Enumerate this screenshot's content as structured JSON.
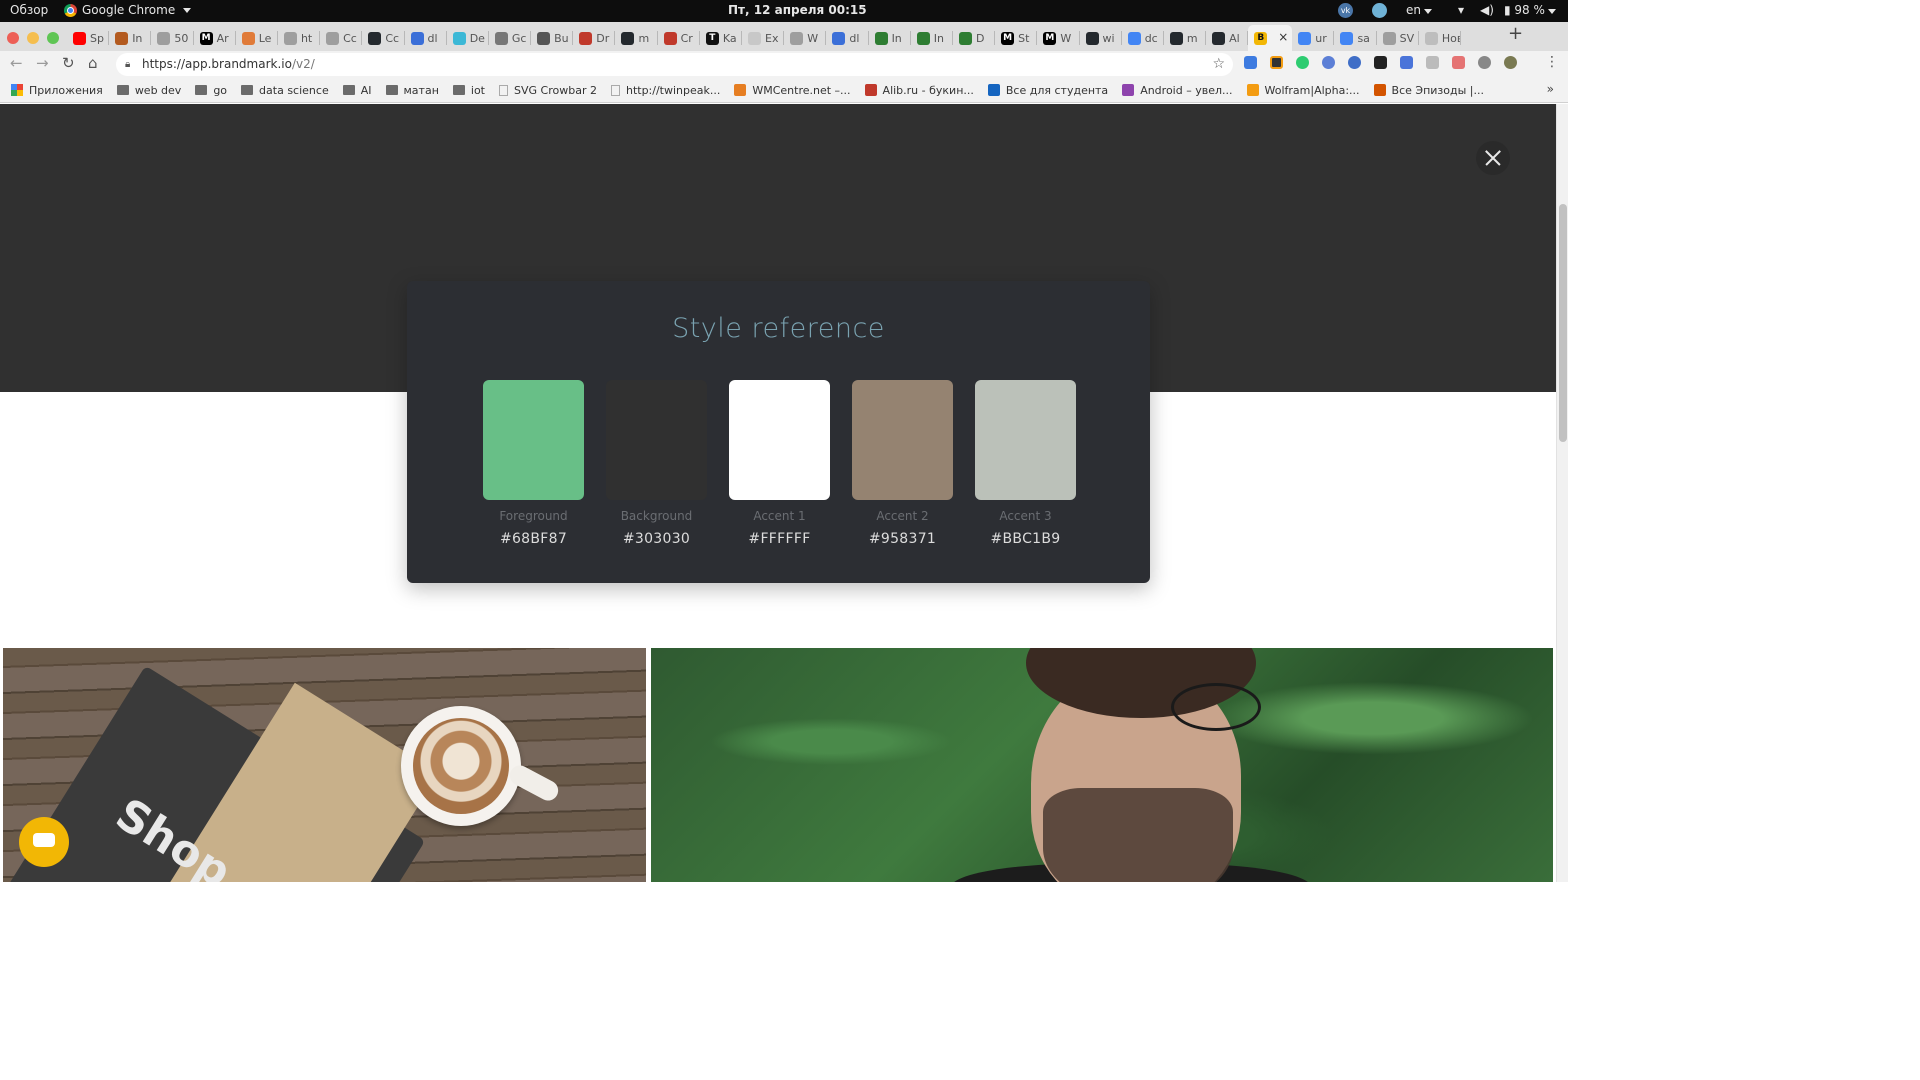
{
  "os_bar": {
    "activities": "Обзор",
    "app_name": "Google Chrome",
    "clock": "Пт, 12 апреля  00:15",
    "lang": "en",
    "battery": "98 %"
  },
  "tabs": [
    {
      "label": "Sp",
      "color": "#ff0000"
    },
    {
      "label": "In",
      "color": "#b35a1f"
    },
    {
      "label": "50",
      "color": "#9e9e9e"
    },
    {
      "label": "Ar",
      "color": "#000000",
      "glyph": "M"
    },
    {
      "label": "Le",
      "color": "#e07b39"
    },
    {
      "label": "ht",
      "color": "#9e9e9e"
    },
    {
      "label": "Cc",
      "color": "#9e9e9e"
    },
    {
      "label": "Cc",
      "color": "#24292e"
    },
    {
      "label": "dl",
      "color": "#3b6fd8"
    },
    {
      "label": "De",
      "color": "#3cb8d6"
    },
    {
      "label": "Gc",
      "color": "#777777"
    },
    {
      "label": "Bu",
      "color": "#555555"
    },
    {
      "label": "Dr",
      "color": "#c0392b"
    },
    {
      "label": "m",
      "color": "#24292e"
    },
    {
      "label": "Cr",
      "color": "#c0392b"
    },
    {
      "label": "Ka",
      "color": "#111111",
      "glyph": "T"
    },
    {
      "label": "Ex",
      "color": "#c8c8c8"
    },
    {
      "label": "W",
      "color": "#9e9e9e"
    },
    {
      "label": "dl",
      "color": "#3b6fd8"
    },
    {
      "label": "In",
      "color": "#2e7d32"
    },
    {
      "label": "In",
      "color": "#2e7d32"
    },
    {
      "label": "D",
      "color": "#2e7d32"
    },
    {
      "label": "St",
      "color": "#000000",
      "glyph": "M"
    },
    {
      "label": "W",
      "color": "#000000",
      "glyph": "M"
    },
    {
      "label": "wi",
      "color": "#24292e"
    },
    {
      "label": "dc",
      "color": "#4285f4"
    },
    {
      "label": "m",
      "color": "#24292e"
    },
    {
      "label": "Al",
      "color": "#24292e"
    },
    {
      "label": "",
      "color": "#f2b705",
      "glyph": "B",
      "active": true
    },
    {
      "label": "ur",
      "color": "#4285f4"
    },
    {
      "label": "sa",
      "color": "#4285f4"
    },
    {
      "label": "SV",
      "color": "#9e9e9e"
    },
    {
      "label": "Новая",
      "color": "#bdbdbd"
    }
  ],
  "toolbar": {
    "url_host": "https://app.brandmark.io",
    "url_path": "/v2/"
  },
  "bookmarks": [
    {
      "label": "Приложения",
      "icon": "apps-grid"
    },
    {
      "label": "web dev",
      "icon": "folder"
    },
    {
      "label": "go",
      "icon": "folder"
    },
    {
      "label": "data science",
      "icon": "folder"
    },
    {
      "label": "AI",
      "icon": "folder"
    },
    {
      "label": "матан",
      "icon": "folder"
    },
    {
      "label": "iot",
      "icon": "folder"
    },
    {
      "label": "SVG Crowbar 2",
      "icon": "page"
    },
    {
      "label": "http://twinpeak...",
      "icon": "page"
    },
    {
      "label": "WMCentre.net –...",
      "icon": "site"
    },
    {
      "label": "Alib.ru - букин...",
      "icon": "site"
    },
    {
      "label": "Все для студента",
      "icon": "site"
    },
    {
      "label": "Android – увел...",
      "icon": "site"
    },
    {
      "label": "Wolfram|Alpha:...",
      "icon": "site"
    },
    {
      "label": "Все Эпизоды |...",
      "icon": "site"
    }
  ],
  "style_reference": {
    "title": "Style reference",
    "swatches": [
      {
        "label": "Foreground",
        "hex": "#68BF87",
        "color": "#68BF87"
      },
      {
        "label": "Background",
        "hex": "#303030",
        "color": "#303030"
      },
      {
        "label": "Accent 1",
        "hex": "#FFFFFF",
        "color": "#FFFFFF"
      },
      {
        "label": "Accent 2",
        "hex": "#958371",
        "color": "#958371"
      },
      {
        "label": "Accent 3",
        "hex": "#BBC1B9",
        "color": "#BBC1B9"
      }
    ]
  },
  "photos": {
    "left_text": "Shop"
  }
}
